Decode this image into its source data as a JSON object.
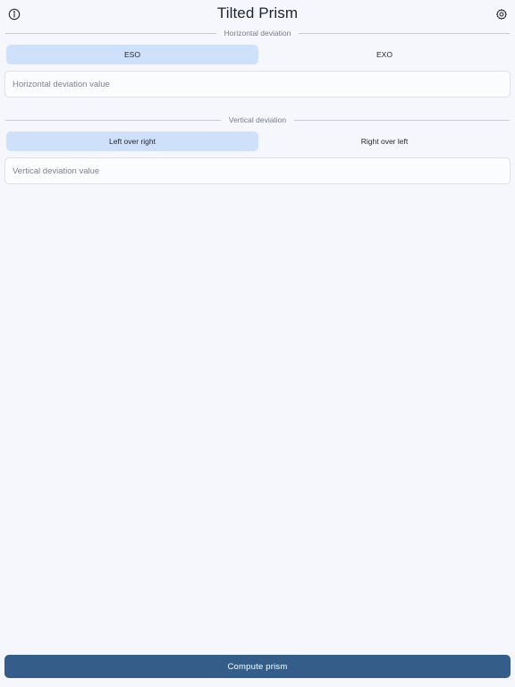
{
  "header": {
    "title": "Tilted Prism",
    "left_icon": "info-icon",
    "right_icon": "gear-icon"
  },
  "horizontal": {
    "section_label": "Horizontal deviation",
    "options": [
      "ESO",
      "EXO"
    ],
    "selected_option": "ESO",
    "value": "",
    "placeholder": "Horizontal deviation value"
  },
  "vertical": {
    "section_label": "Vertical deviation",
    "options": [
      "Left over right",
      "Right over left"
    ],
    "selected_option": "Left over right",
    "value": "",
    "placeholder": "Vertical deviation value"
  },
  "actions": {
    "compute_label": "Compute prism"
  },
  "colors": {
    "background": "#f6f7fc",
    "segment_selected": "#cfe0fb",
    "primary_button": "#345d8a",
    "divider": "#c7cbd6"
  }
}
